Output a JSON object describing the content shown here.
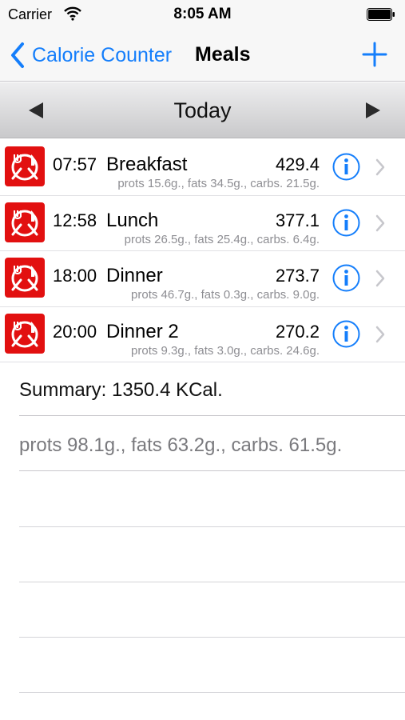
{
  "status_bar": {
    "carrier": "Carrier",
    "time": "8:05 AM",
    "icons": [
      "wifi-icon",
      "battery-icon"
    ]
  },
  "nav": {
    "back_label": "Calorie Counter",
    "title": "Meals",
    "add_icon": "plus-icon",
    "accent_color": "#147efb"
  },
  "date_bar": {
    "label": "Today"
  },
  "meals": [
    {
      "time": "07:57",
      "name": "Breakfast",
      "calories": "429.4",
      "macros": "prots 15.6g., fats 34.5g., carbs. 21.5g."
    },
    {
      "time": "12:58",
      "name": "Lunch",
      "calories": "377.1",
      "macros": "prots 26.5g., fats 25.4g., carbs. 6.4g."
    },
    {
      "time": "18:00",
      "name": "Dinner",
      "calories": "273.7",
      "macros": "prots 46.7g., fats 0.3g., carbs. 9.0g."
    },
    {
      "time": "20:00",
      "name": "Dinner 2",
      "calories": "270.2",
      "macros": "prots 9.3g., fats 3.0g., carbs. 24.6g."
    }
  ],
  "summary": {
    "total": "Summary: 1350.4 KCal.",
    "macros": "prots 98.1g., fats 63.2g., carbs. 61.5g."
  },
  "colors": {
    "meal_icon_bg": "#e21010",
    "secondary_text": "#8e8e93"
  }
}
